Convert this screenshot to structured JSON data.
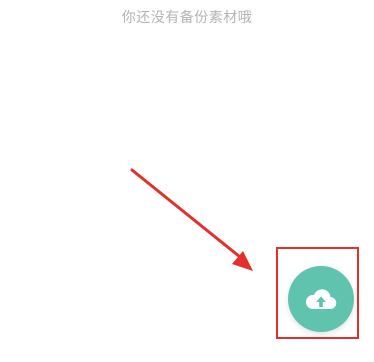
{
  "empty_state": {
    "message": "你还没有备份素材哦"
  },
  "upload_fab": {
    "icon": "cloud-upload-icon"
  },
  "colors": {
    "fab_background": "#5fc3ad",
    "annotation_red": "#e3302a",
    "message_text": "#b4b4b4"
  }
}
